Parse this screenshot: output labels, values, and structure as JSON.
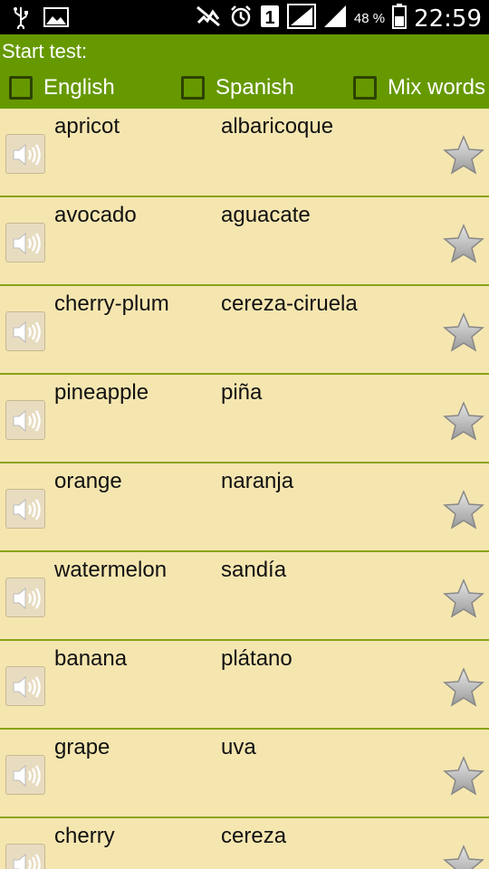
{
  "status_bar": {
    "battery_percent": "48 %",
    "time": "22:59",
    "sim_slot": "1",
    "icons": [
      "usb-icon",
      "image-icon",
      "mute-icon",
      "alarm-icon",
      "sim-icon",
      "signal-icon",
      "signal-icon",
      "battery-icon"
    ]
  },
  "header": {
    "title": "Start test:",
    "checkboxes": [
      {
        "label": "English",
        "checked": false
      },
      {
        "label": "Spanish",
        "checked": false
      },
      {
        "label": "Mix words",
        "checked": false
      }
    ]
  },
  "words": [
    {
      "english": "apricot",
      "spanish": "albaricoque"
    },
    {
      "english": "avocado",
      "spanish": "aguacate"
    },
    {
      "english": "cherry-plum",
      "spanish": "cereza-ciruela"
    },
    {
      "english": "pineapple",
      "spanish": "piña"
    },
    {
      "english": "orange",
      "spanish": "naranja"
    },
    {
      "english": "watermelon",
      "spanish": "sandía"
    },
    {
      "english": "banana",
      "spanish": "plátano"
    },
    {
      "english": "grape",
      "spanish": "uva"
    },
    {
      "english": "cherry",
      "spanish": "cereza"
    }
  ],
  "colors": {
    "header_bg": "#669900",
    "list_bg": "#f5e6b0",
    "divider": "#8aa317"
  }
}
